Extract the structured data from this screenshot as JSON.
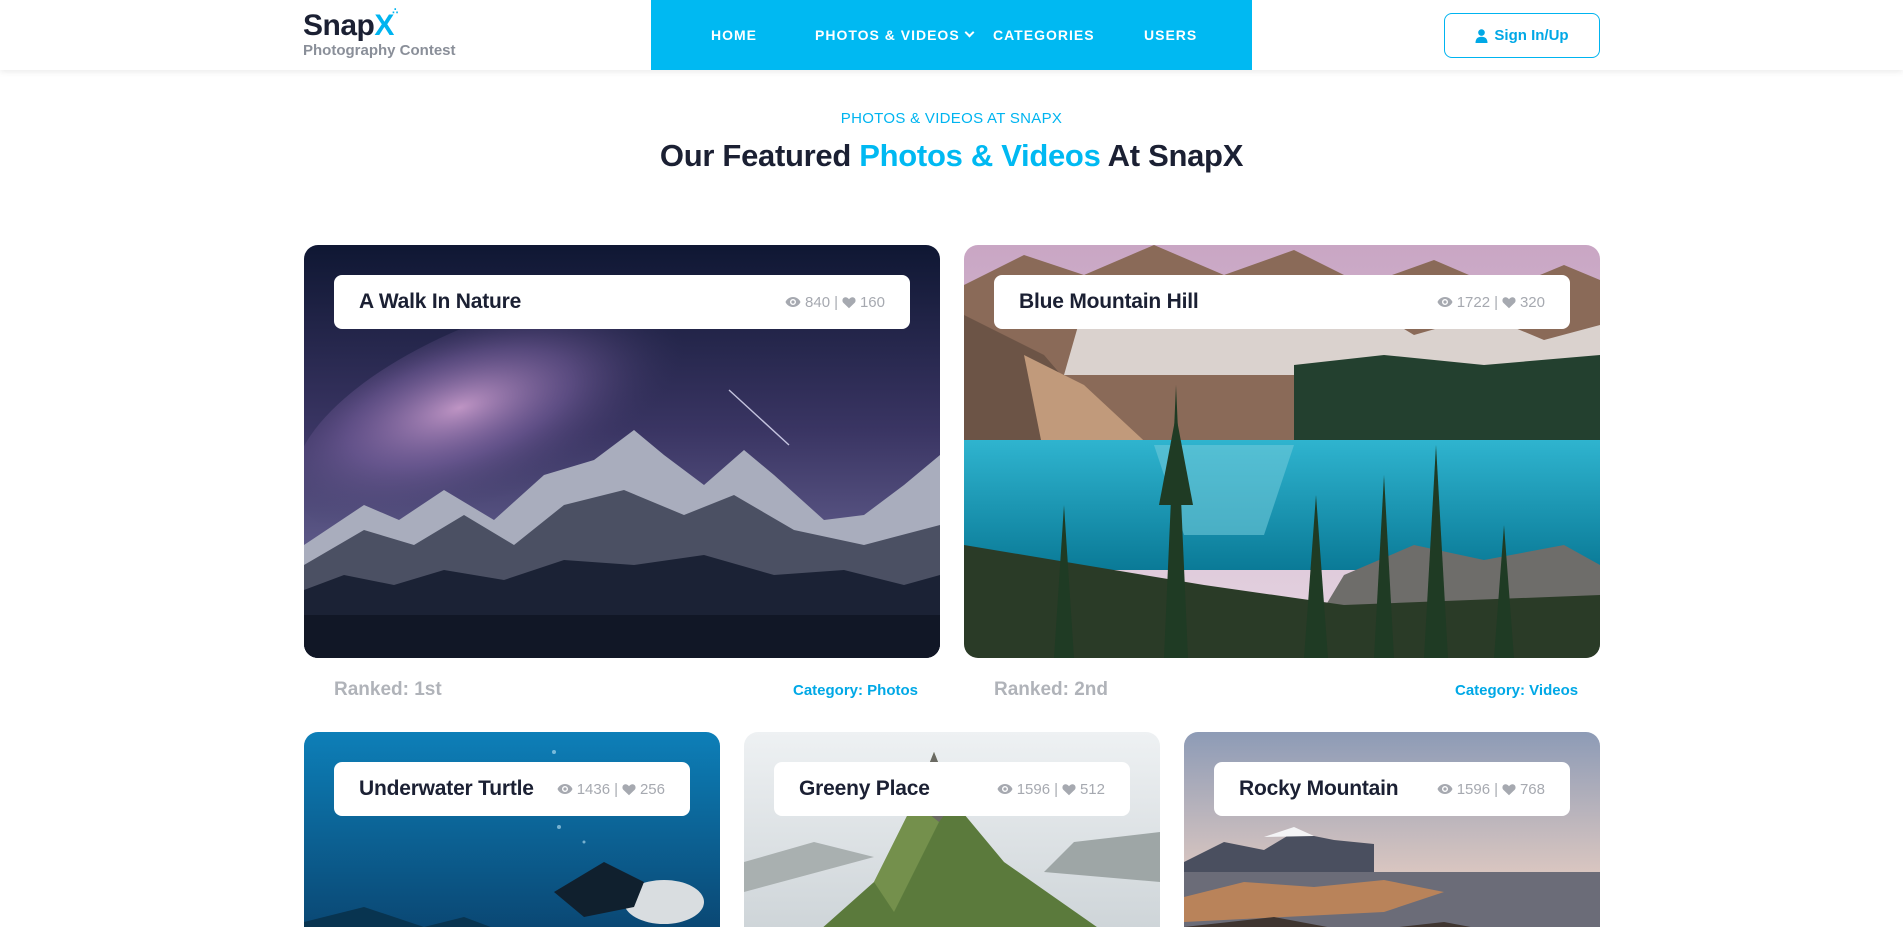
{
  "brand": {
    "name_main": "Snap",
    "name_accent": "X",
    "tagline": "Photography Contest"
  },
  "nav": {
    "items": [
      {
        "label": "HOME"
      },
      {
        "label": "PHOTOS & VIDEOS",
        "has_dropdown": true
      },
      {
        "label": "CATEGORIES"
      },
      {
        "label": "USERS"
      }
    ]
  },
  "auth": {
    "label": "Sign In/Up",
    "icon": "user-icon"
  },
  "section": {
    "eyebrow": "PHOTOS & VIDEOS AT SNAPX",
    "title_prefix": "Our Featured ",
    "title_highlight": "Photos & Videos",
    "title_suffix": " At SnapX"
  },
  "featured": [
    {
      "title": "A Walk In Nature",
      "views": "840",
      "likes": "160",
      "rank": "Ranked: 1st",
      "category": "Category: Photos"
    },
    {
      "title": "Blue Mountain Hill",
      "views": "1722",
      "likes": "320",
      "rank": "Ranked: 2nd",
      "category": "Category: Videos"
    }
  ],
  "grid": [
    {
      "title": "Underwater Turtle",
      "views": "1436",
      "likes": "256"
    },
    {
      "title": "Greeny Place",
      "views": "1596",
      "likes": "512"
    },
    {
      "title": "Rocky Mountain",
      "views": "1596",
      "likes": "768"
    }
  ],
  "colors": {
    "accent": "#00b9f2",
    "text_dark": "#1b2033",
    "muted": "#a6a9b0"
  }
}
